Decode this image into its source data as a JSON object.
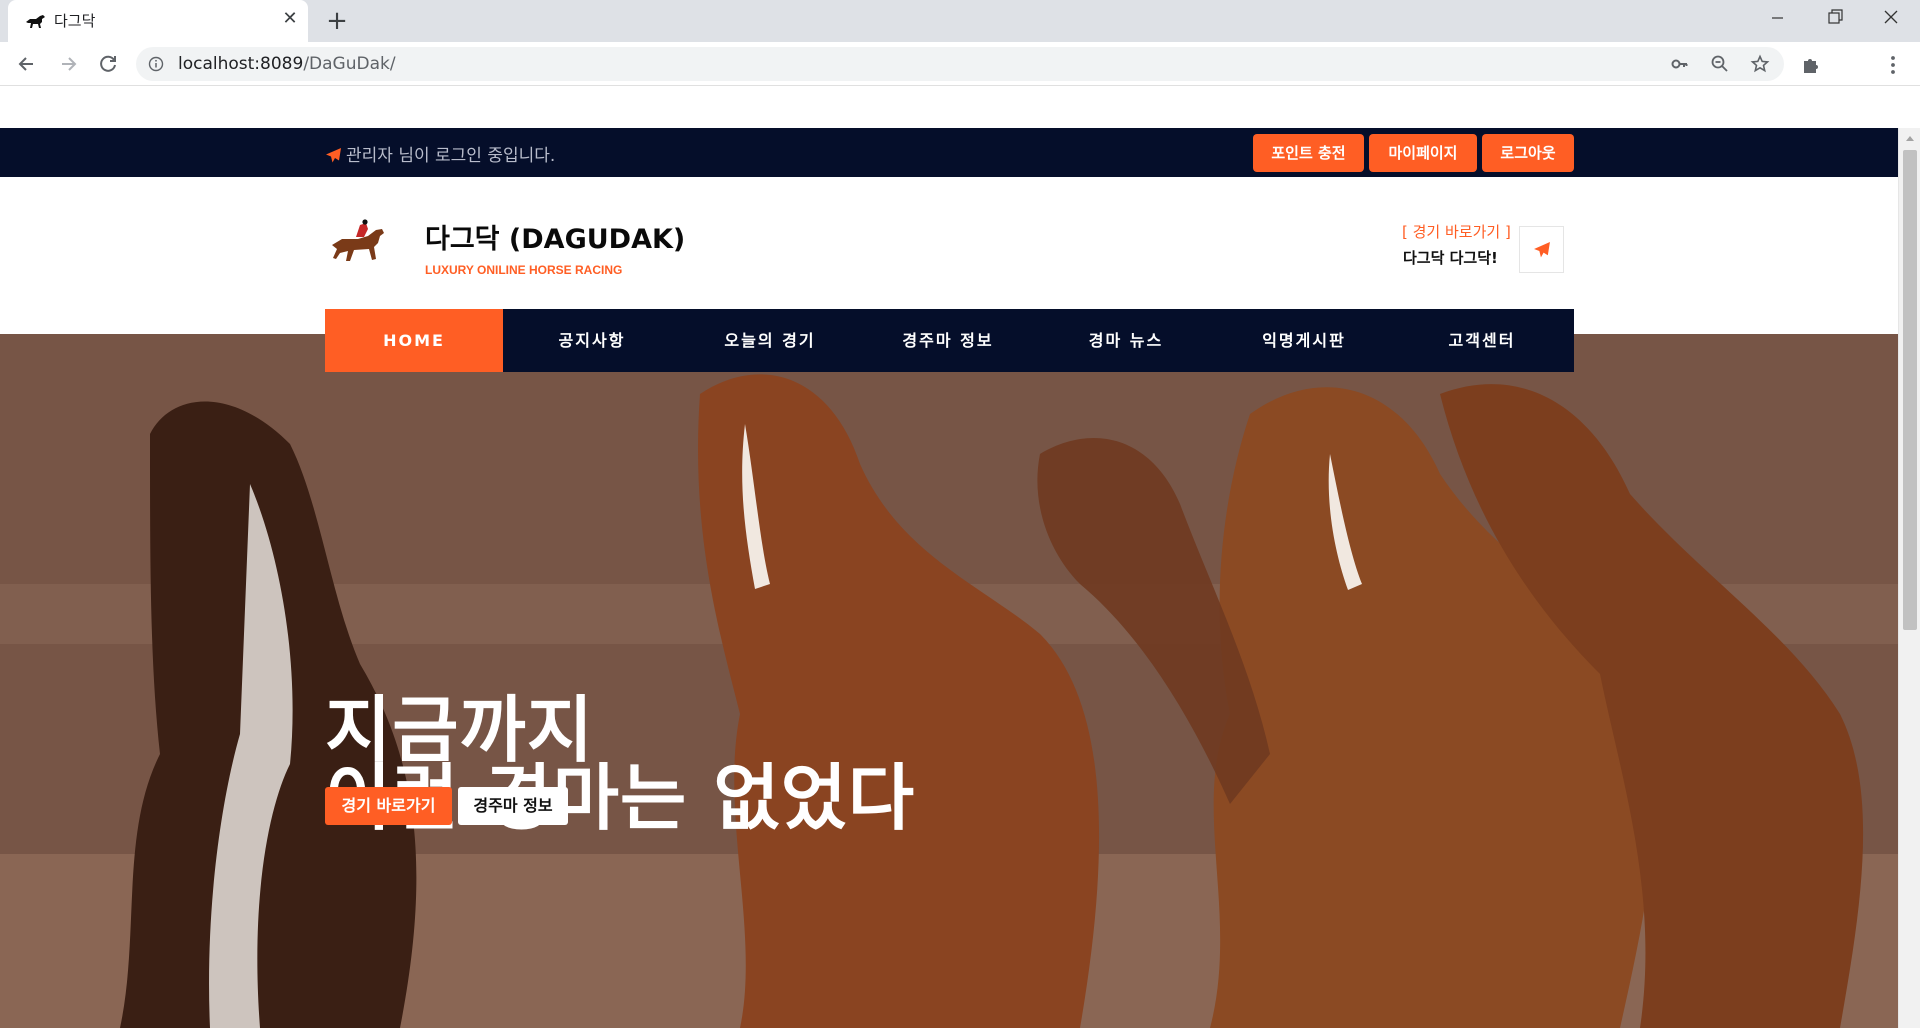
{
  "browser": {
    "tab_title": "다그닥",
    "url_host": "localhost:8089",
    "url_path": "/DaGuDak/",
    "icons": [
      "horse-favicon-icon",
      "close-icon",
      "plus-icon",
      "back-icon",
      "forward-icon",
      "reload-icon",
      "info-icon",
      "key-icon",
      "zoom-out-icon",
      "star-icon",
      "puzzle-icon",
      "kebab-menu-icon",
      "minimize-icon",
      "restore-icon",
      "window-close-icon"
    ]
  },
  "topbar": {
    "login_message": "관리자 님이 로그인 중입니다.",
    "buttons": {
      "point": "포인트 충전",
      "mypage": "마이페이지",
      "logout": "로그아웃"
    }
  },
  "header": {
    "brand_name": "다그닥 (DAGUDAK)",
    "brand_sub": "LUXURY ONILINE HORSE RACING",
    "quick_link": "[ 경기 바로가기 ]",
    "quick_text": "다그닥 다그닥!"
  },
  "nav": {
    "items": [
      "HOME",
      "공지사항",
      "오늘의 경기",
      "경주마 정보",
      "경마 뉴스",
      "익명게시판",
      "고객센터"
    ]
  },
  "hero": {
    "line1": "지금까지",
    "line2": "이런 경마는 없었다",
    "button_primary": "경기 바로가기",
    "button_secondary": "경주마 정보"
  },
  "colors": {
    "accent": "#ff5e24",
    "navy": "#050e2a"
  }
}
